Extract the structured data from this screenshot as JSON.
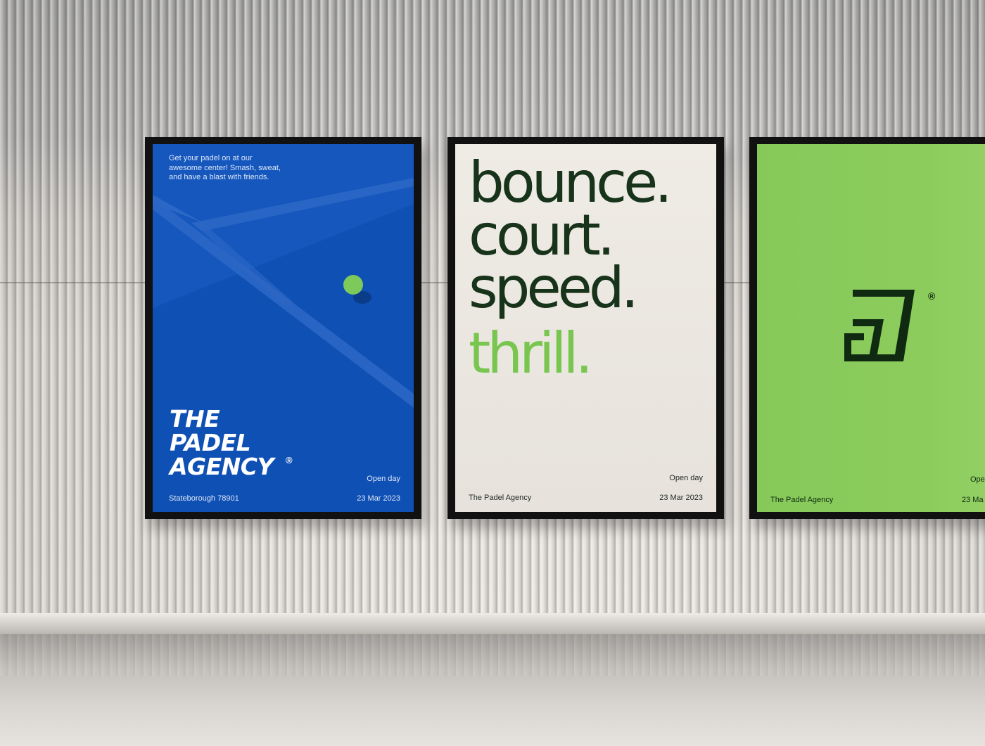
{
  "poster_blue": {
    "tagline": "Get your padel on at our\nawesome center! Smash, sweat,\nand have a blast with friends.",
    "title_line1": "THE",
    "title_line2": "PADEL",
    "title_line3": "AGENCY",
    "registered": "®",
    "event": "Open day",
    "location": "Stateborough 78901",
    "date": "23 Mar 2023",
    "background_color": "#0f50b4",
    "ball_color": "#7dc95a"
  },
  "poster_cream": {
    "word1": "bounce.",
    "word2": "court.",
    "word3": "speed.",
    "word4": "thrill.",
    "event": "Open day",
    "brand": "The Padel Agency",
    "date": "23 Mar 2023",
    "text_color": "#17331a",
    "accent_color": "#78c650"
  },
  "poster_green": {
    "registered": "®",
    "event": "Ope",
    "brand": "The Padel Agency",
    "date": "23 Ma",
    "background_color": "#8ccc5d",
    "logo": "padel-agency-monogram-icon"
  }
}
